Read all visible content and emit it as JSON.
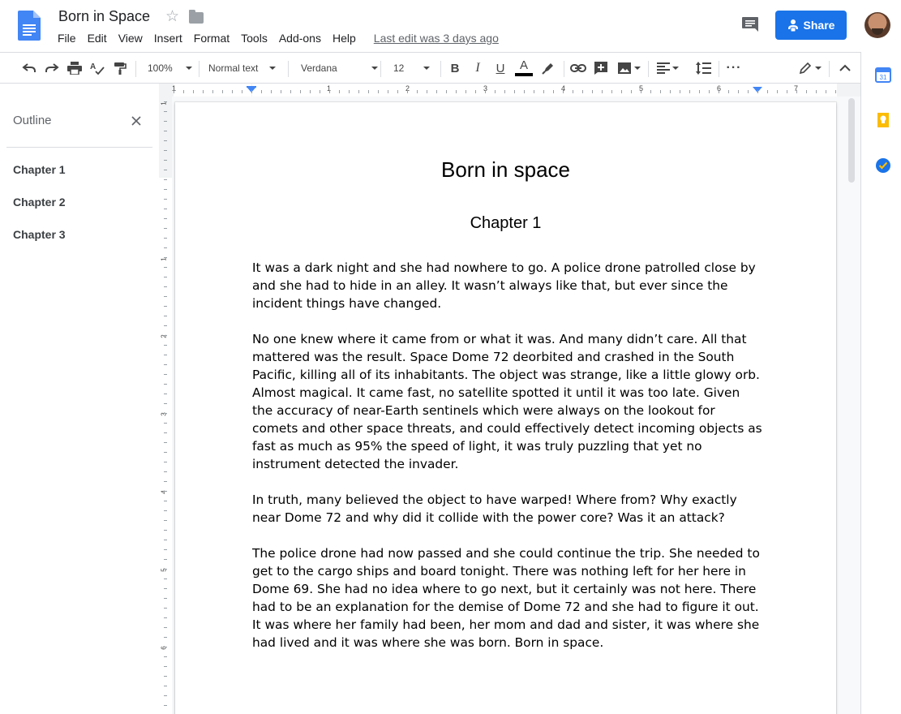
{
  "header": {
    "doc_title": "Born in Space",
    "share_label": "Share",
    "last_edit": "Last edit was 3 days ago"
  },
  "menu": [
    "File",
    "Edit",
    "View",
    "Insert",
    "Format",
    "Tools",
    "Add-ons",
    "Help"
  ],
  "toolbar": {
    "zoom": "100%",
    "style": "Normal text",
    "font": "Verdana",
    "font_size": "12"
  },
  "ruler": {
    "h_numbers": [
      "1",
      "1",
      "2",
      "3",
      "4",
      "5",
      "6",
      "7"
    ],
    "v_numbers": [
      "1",
      "1",
      "2",
      "3",
      "4",
      "5",
      "6"
    ]
  },
  "outline": {
    "title": "Outline",
    "items": [
      "Chapter 1",
      "Chapter 2",
      "Chapter 3"
    ]
  },
  "document": {
    "title": "Born in space",
    "chapter": "Chapter 1",
    "paragraphs": [
      "It was a dark night and she had nowhere to go. A police drone patrolled close by and she had to hide in an alley. It wasn’t always like that, but ever since the incident things have changed.",
      "No one knew where it came from or what it was. And many didn’t care. All that mattered was the result. Space Dome 72 deorbited and crashed in the South Pacific, killing all of its inhabitants. The object was strange, like a little glowy orb. Almost magical. It came fast, no satellite spotted it until it was too late. Given the accuracy of near-Earth sentinels which were always on the lookout for comets and other space threats, and could effectively detect incoming objects as fast as much as 95% the speed of light, it was truly puzzling that yet no instrument detected the invader.",
      "In truth, many believed the object to have warped! Where from? Why exactly near Dome 72 and why did it collide with the power core? Was it an attack?",
      "The police drone had now passed and she could continue the trip. She needed to get to the cargo ships and board tonight. There was nothing left for her here in Dome 69. She had no idea where to go next, but it certainly was not here. There had to be an explanation for the demise of Dome 72 and she had to figure it out. It was where her family had been, her mom and dad and sister, it was where she had lived and it was where she was born. Born in space."
    ]
  },
  "colors": {
    "accent": "#1a73e8",
    "docs_blue": "#4285f4",
    "keep_yellow": "#fbbc04",
    "text_color_bar": "#000000"
  }
}
